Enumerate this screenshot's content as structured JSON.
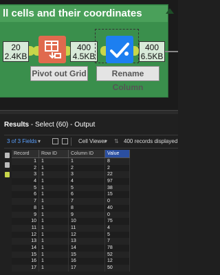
{
  "workflow": {
    "container_title": "ll cells and their coordinates",
    "tools": [
      {
        "name": "pivot-out-grid",
        "label": "Pivot out Grid",
        "color": "#e06a4e"
      },
      {
        "name": "rename-column",
        "label": "Rename Column",
        "color": "#1d7ff0"
      }
    ],
    "badges": [
      {
        "count": "20",
        "size": "2.4KB"
      },
      {
        "count": "400",
        "size": "4.5KB"
      },
      {
        "count": "400",
        "size": "6.5KB"
      }
    ]
  },
  "results": {
    "header_label": "Results",
    "header_detail": " - Select (60) - Output",
    "fields_link": "3 of 3 Fields",
    "viewer_label": "Cell Viewer",
    "records_info": "400 records displayed",
    "columns": [
      "Record",
      "Row ID",
      "Column ID",
      "Value"
    ],
    "rows": [
      [
        "1",
        "1",
        "1",
        "8"
      ],
      [
        "2",
        "1",
        "2",
        "2"
      ],
      [
        "3",
        "1",
        "3",
        "22"
      ],
      [
        "4",
        "1",
        "4",
        "97"
      ],
      [
        "5",
        "1",
        "5",
        "38"
      ],
      [
        "6",
        "1",
        "6",
        "15"
      ],
      [
        "7",
        "1",
        "7",
        "0"
      ],
      [
        "8",
        "1",
        "8",
        "40"
      ],
      [
        "9",
        "1",
        "9",
        "0"
      ],
      [
        "10",
        "1",
        "10",
        "75"
      ],
      [
        "11",
        "1",
        "11",
        "4"
      ],
      [
        "12",
        "1",
        "12",
        "5"
      ],
      [
        "13",
        "1",
        "13",
        "7"
      ],
      [
        "14",
        "1",
        "14",
        "78"
      ],
      [
        "15",
        "1",
        "15",
        "52"
      ],
      [
        "16",
        "1",
        "16",
        "12"
      ],
      [
        "17",
        "1",
        "17",
        "50"
      ]
    ]
  },
  "colors": {
    "container_green": "#3a8f4c",
    "title_green": "#4aa05a",
    "accent_blue": "#2b4fa0",
    "link_blue": "#5aa0ff"
  }
}
